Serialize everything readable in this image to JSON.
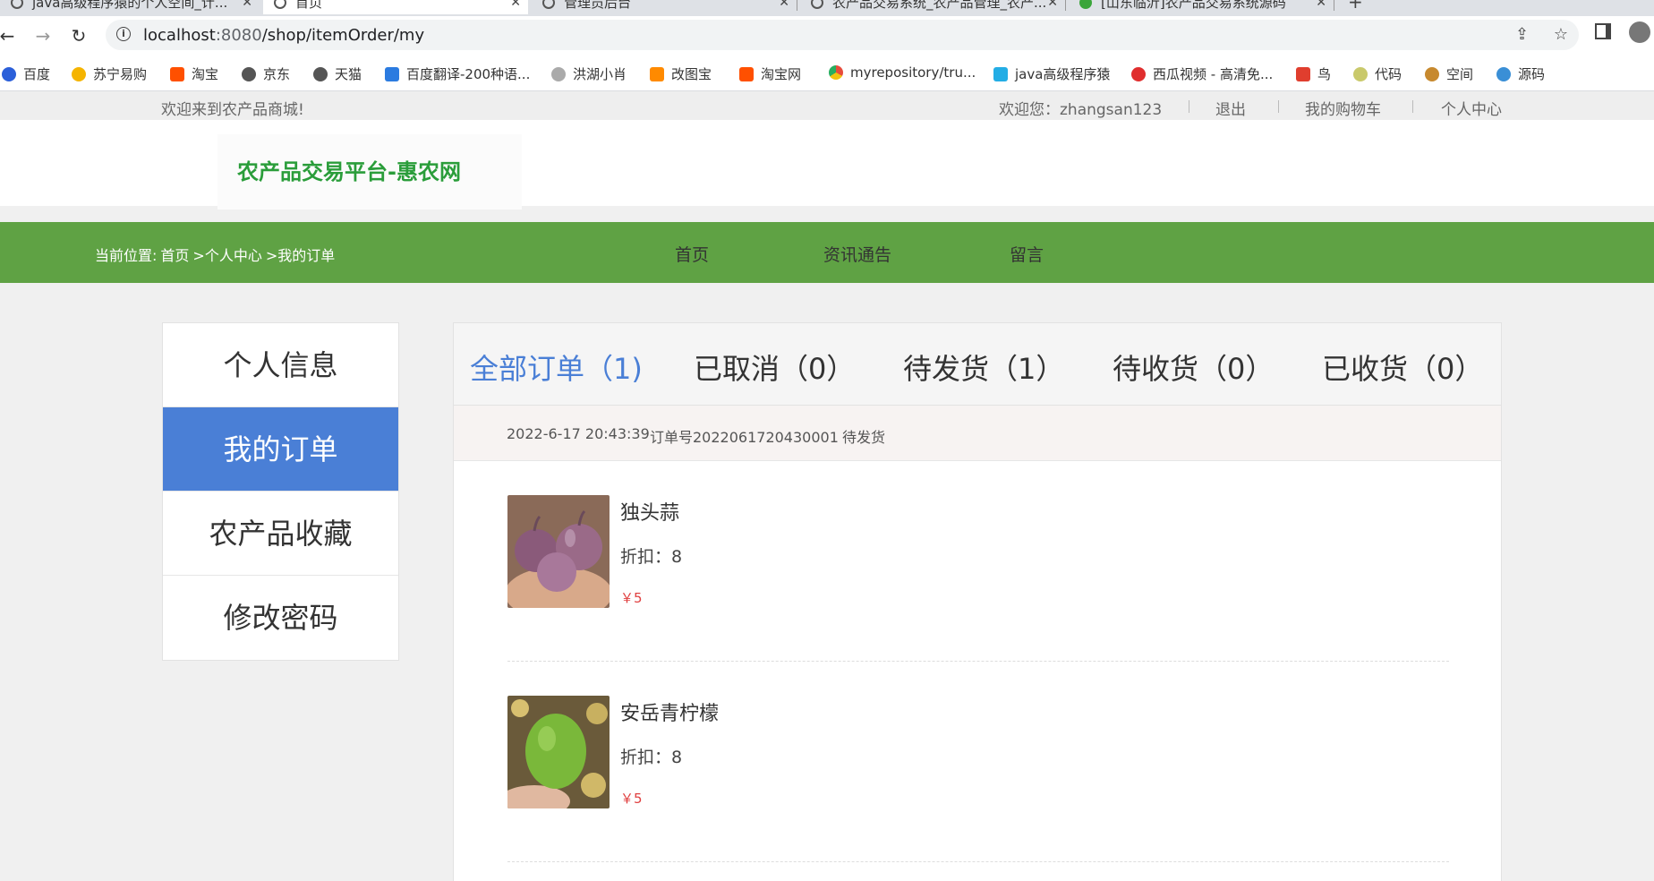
{
  "browser": {
    "tabs": [
      {
        "title": "java高级程序猿的个人空间_计..."
      },
      {
        "title": "首页"
      },
      {
        "title": "管理员后台"
      },
      {
        "title": "农产品交易系统_农产品管理_农产..."
      },
      {
        "title": "[山东临沂]农产品交易系统源码"
      }
    ],
    "url": {
      "host": "localhost",
      "port": ":8080",
      "path": "/shop/itemOrder/my"
    },
    "bookmarks": [
      {
        "label": "百度",
        "color": "#2b5fd9"
      },
      {
        "label": "苏宁易购",
        "color": "#f5b400"
      },
      {
        "label": "淘宝",
        "color": "#ff5000"
      },
      {
        "label": "京东",
        "color": "#555555"
      },
      {
        "label": "天猫",
        "color": "#555555"
      },
      {
        "label": "百度翻译-200种语...",
        "color": "#2b7be0"
      },
      {
        "label": "洪湖小肖",
        "color": "#888888"
      },
      {
        "label": "改图宝",
        "color": "#ff8a00"
      },
      {
        "label": "淘宝网",
        "color": "#ff5000"
      },
      {
        "label": "myrepository/tru...",
        "color": "#e74c3c"
      },
      {
        "label": "java高级程序猿",
        "color": "#23ade5"
      },
      {
        "label": "西瓜视频 - 高清免...",
        "color": "#e02e2e"
      },
      {
        "label": "鸟",
        "color": "#e03e2e"
      },
      {
        "label": "代码",
        "color": "#c9c96b"
      },
      {
        "label": "空间",
        "color": "#c7892e"
      },
      {
        "label": "源码",
        "color": "#3a8fd6"
      }
    ]
  },
  "site": {
    "welcome": "欢迎来到农产品商城!",
    "user_greeting": "欢迎您：zhangsan123",
    "logout": "退出",
    "cart": "我的购物车",
    "user_center": "个人中心",
    "logo_text": "农产品交易平台-惠农网",
    "breadcrumb": {
      "prefix": "当前位置:",
      "home": "首页",
      "sep1": ">个人中心",
      "sep2": ">我的订单"
    },
    "nav": [
      "首页",
      "资讯通告",
      "留言"
    ],
    "accent": "#5fa244"
  },
  "sidebar": {
    "items": [
      {
        "label": "个人信息",
        "active": false
      },
      {
        "label": "我的订单",
        "active": true
      },
      {
        "label": "农产品收藏",
        "active": false
      },
      {
        "label": "修改密码",
        "active": false
      }
    ]
  },
  "orders": {
    "tabs": [
      {
        "label": "全部订单（1)",
        "active": true
      },
      {
        "label": "已取消（0）",
        "active": false
      },
      {
        "label": "待发货（1）",
        "active": false
      },
      {
        "label": "待收货（0）",
        "active": false
      },
      {
        "label": "已收货（0）",
        "active": false
      }
    ],
    "order": {
      "time": "2022-6-17 20:43:39",
      "number": "订单号2022061720430001",
      "status": "待发货"
    },
    "items": [
      {
        "name": "独头蒜",
        "discount": "折扣：8",
        "price": "￥5",
        "image": "garlic"
      },
      {
        "name": "安岳青柠檬",
        "discount": "折扣：8",
        "price": "￥5",
        "image": "lime"
      }
    ]
  }
}
